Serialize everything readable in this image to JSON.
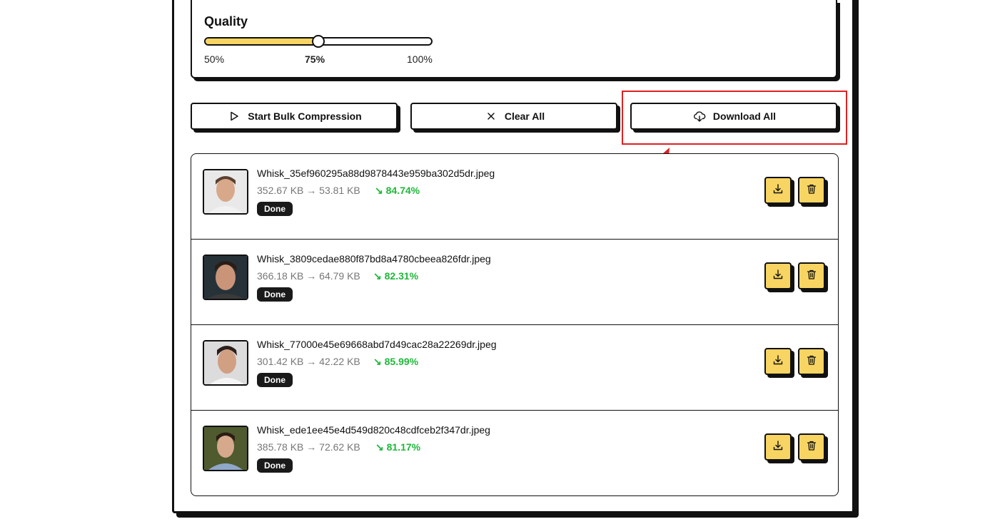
{
  "quality": {
    "title": "Quality",
    "min_label": "50%",
    "current_label": "75%",
    "max_label": "100%",
    "value_percent": 75,
    "min": 50,
    "max": 100
  },
  "actions": {
    "start_label": "Start Bulk Compression",
    "clear_label": "Clear All",
    "download_label": "Download All"
  },
  "files": [
    {
      "name": "Whisk_35ef960295a88d9878443e959ba302d5dr.jpeg",
      "original": "352.67 KB",
      "compressed": "53.81 KB",
      "arrow": "→",
      "saving": "84.74%",
      "status": "Done"
    },
    {
      "name": "Whisk_3809cedae880f87bd8a4780cbeea826fdr.jpeg",
      "original": "366.18 KB",
      "compressed": "64.79 KB",
      "arrow": "→",
      "saving": "82.31%",
      "status": "Done"
    },
    {
      "name": "Whisk_77000e45e69668abd7d49cac28a22269dr.jpeg",
      "original": "301.42 KB",
      "compressed": "42.22 KB",
      "arrow": "→",
      "saving": "85.99%",
      "status": "Done"
    },
    {
      "name": "Whisk_ede1ee45e4d549d820c48cdfceb2f347dr.jpeg",
      "original": "385.78 KB",
      "compressed": "72.62 KB",
      "arrow": "→",
      "saving": "81.17%",
      "status": "Done"
    }
  ],
  "colors": {
    "accent": "#f8d562",
    "success": "#1fb83a",
    "highlight": "#e02020"
  },
  "icons": {
    "start": "play-icon",
    "clear": "close-icon",
    "download_all": "cloud-download-icon",
    "row_download": "download-icon",
    "row_delete": "trash-icon",
    "saving": "trending-down-icon"
  }
}
